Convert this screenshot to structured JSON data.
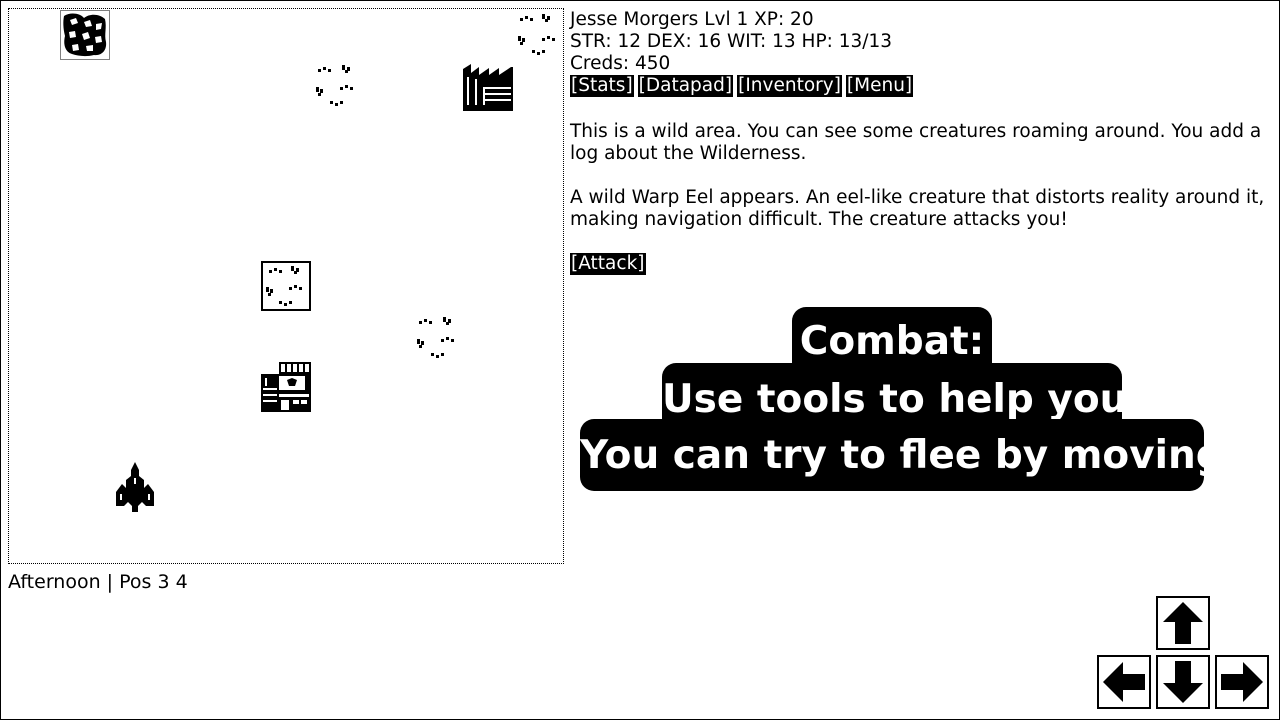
{
  "player": {
    "line1": "Jesse Morgers Lvl 1 XP: 20",
    "line2": "STR: 12 DEX: 16 WIT: 13 HP: 13/13",
    "line3": "Creds: 450"
  },
  "menu": {
    "stats": "[Stats]",
    "datapad": "[Datapad]",
    "inventory": "[Inventory]",
    "menu": "[Menu]"
  },
  "log": {
    "area": "This is a wild area. You can see some creatures roaming around. You add a log about the Wilderness.",
    "encounter": "A wild Warp Eel appears. An eel-like creature that distorts reality around it, making navigation difficult. The creature attacks you!"
  },
  "actions": {
    "attack": "[Attack]"
  },
  "tip": {
    "line1": "Combat:",
    "line2": "Use tools to help you.",
    "line3": "You can try to flee by moving."
  },
  "status": "Afternoon | Pos 3 4",
  "controls": [
    "arrow-up-icon",
    "arrow-left-icon",
    "arrow-down-icon",
    "arrow-right-icon"
  ]
}
